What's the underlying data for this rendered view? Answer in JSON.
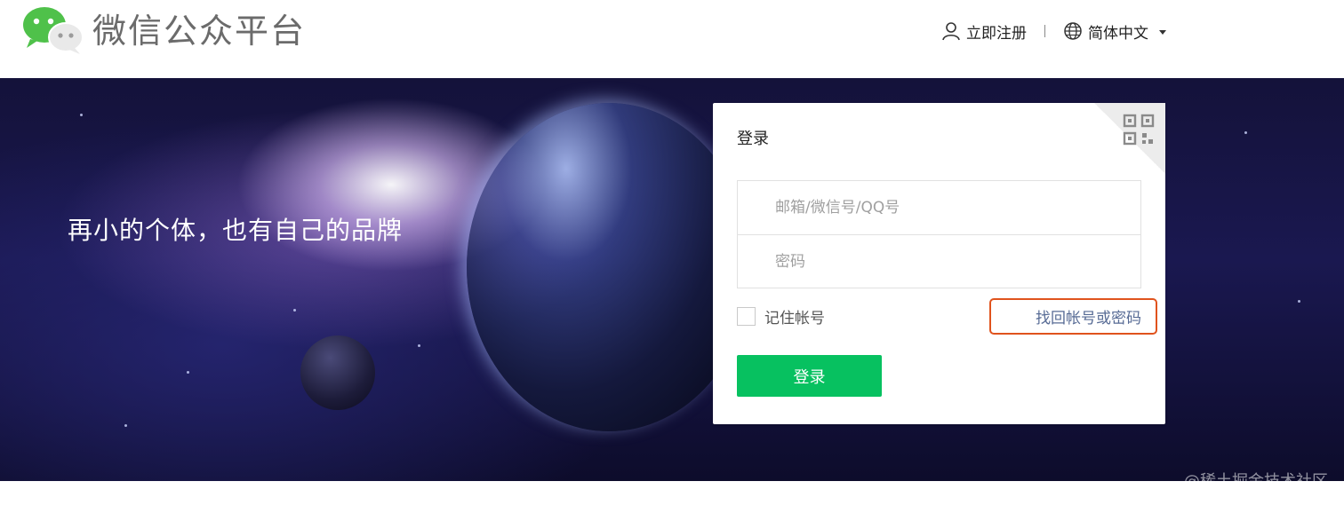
{
  "header": {
    "brand": "微信公众平台",
    "register_label": "立即注册",
    "language_label": "简体中文"
  },
  "banner": {
    "slogan": "再小的个体，也有自己的品牌"
  },
  "login": {
    "title": "登录",
    "account_placeholder": "邮箱/微信号/QQ号",
    "password_placeholder": "密码",
    "remember_label": "记住帐号",
    "find_label": "找回帐号或密码",
    "submit_label": "登录"
  },
  "watermark": "@稀土掘金技术社区",
  "icons": [
    "wechat-logo-icon",
    "user-icon",
    "globe-icon",
    "caret-down-icon",
    "qr-code-icon"
  ],
  "colors": {
    "primary_button": "#07c160",
    "link": "#576b95",
    "highlight_box": "#e0531d"
  }
}
